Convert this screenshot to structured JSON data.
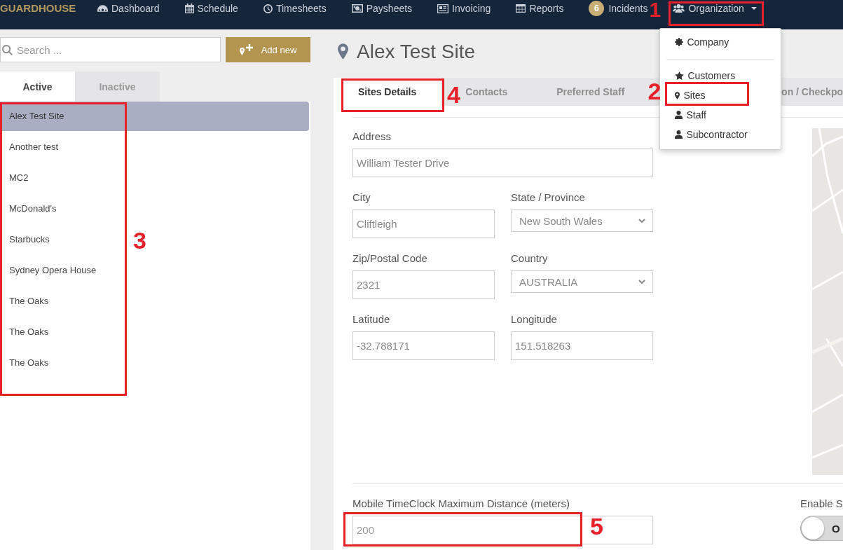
{
  "topbar": {
    "logo": "GUARDHOUSE",
    "items": [
      {
        "label": "Dashboard",
        "kind": "link"
      },
      {
        "label": "Schedule",
        "kind": "link"
      },
      {
        "label": "Timesheets",
        "kind": "link"
      },
      {
        "label": "Paysheets",
        "kind": "link"
      },
      {
        "label": "Invoicing",
        "kind": "link"
      },
      {
        "label": "Reports",
        "kind": "link"
      },
      {
        "label": "Incidents",
        "kind": "badge",
        "badge": "6"
      },
      {
        "label": "Organization",
        "kind": "menu",
        "callout": "1",
        "menu": {
          "groups": [
            {
              "items": [
                {
                  "label": "Company"
                }
              ]
            },
            {
              "items": [
                {
                  "label": "Customers"
                },
                {
                  "label": "Sites",
                  "callout": "2"
                },
                {
                  "label": "Staff"
                },
                {
                  "label": "Subcontractor"
                }
              ]
            }
          ]
        }
      }
    ]
  },
  "sidebar": {
    "search": {
      "placeholder": "Search ..."
    },
    "add_button": {
      "label": "Add new"
    },
    "tabs": [
      {
        "label": "Active",
        "selected": true
      },
      {
        "label": "Inactive",
        "selected": false
      }
    ],
    "sites": {
      "callout": "3",
      "items": [
        {
          "name": "Alex Test Site",
          "selected": true
        },
        {
          "name": "Another test",
          "selected": false
        },
        {
          "name": "MC2",
          "selected": false
        },
        {
          "name": "McDonald's",
          "selected": false
        },
        {
          "name": "Starbucks",
          "selected": false
        },
        {
          "name": "Sydney Opera House",
          "selected": false
        },
        {
          "name": "The Oaks",
          "selected": false
        },
        {
          "name": "The Oaks",
          "selected": false
        },
        {
          "name": "The Oaks",
          "selected": false
        }
      ]
    }
  },
  "main": {
    "title": "Alex Test Site",
    "tabs": [
      {
        "label": "Sites Details",
        "selected": true,
        "callout": "4"
      },
      {
        "label": "Contacts",
        "selected": false
      },
      {
        "label": "Preferred Staff",
        "selected": false
      },
      {
        "label": "on / Checkpo",
        "selected": false
      }
    ],
    "address": {
      "label": "Address",
      "value": "William Tester Drive"
    },
    "fields": [
      {
        "label": "City",
        "kind": "text",
        "value": "Cliftleigh"
      },
      {
        "label": "State / Province",
        "kind": "select",
        "value": "New South Wales"
      },
      {
        "label": "Zip/Postal Code",
        "kind": "text",
        "value": "2321"
      },
      {
        "label": "Country",
        "kind": "select",
        "value": "AUSTRALIA"
      },
      {
        "label": "Latitude",
        "kind": "text",
        "value": "-32.788171"
      },
      {
        "label": "Longitude",
        "kind": "text",
        "value": "151.518263"
      }
    ],
    "distance": {
      "label": "Mobile TimeClock Maximum Distance (meters)",
      "placeholder": "200",
      "callout": "5"
    },
    "toggle": {
      "label": "Enable S",
      "on": false,
      "text": "O"
    }
  }
}
